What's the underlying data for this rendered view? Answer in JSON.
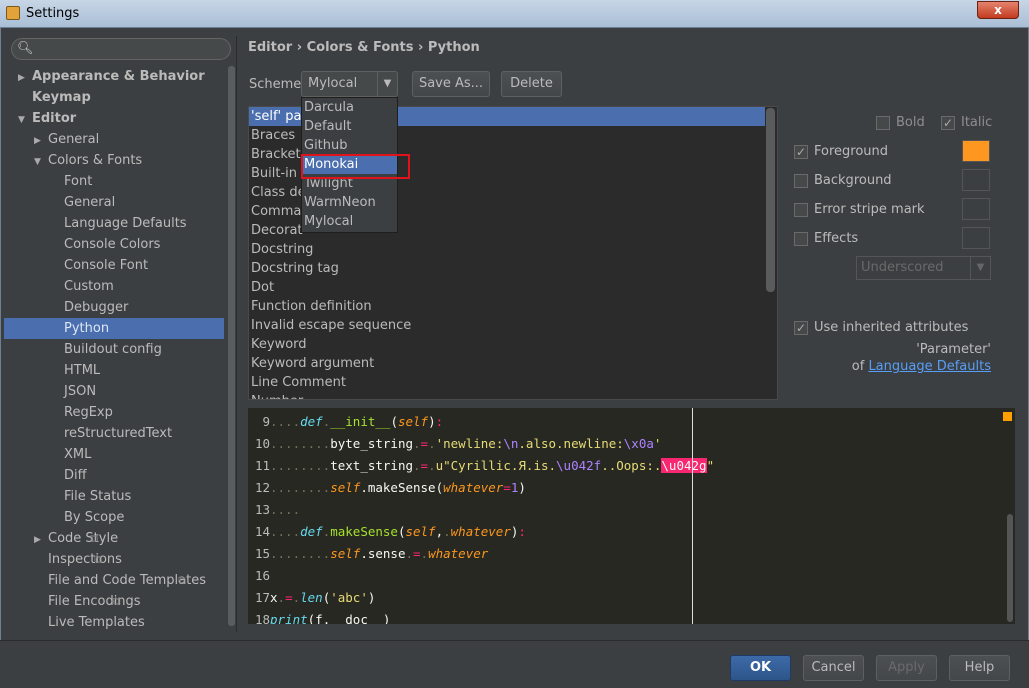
{
  "window": {
    "title": "Settings",
    "close_label": "x"
  },
  "search": {
    "placeholder": ""
  },
  "tree": [
    {
      "label": "Appearance & Behavior",
      "arrow": "▶",
      "bold": true
    },
    {
      "label": "Keymap",
      "arrow": "",
      "bold": true
    },
    {
      "label": "Editor",
      "arrow": "▼",
      "bold": true
    },
    {
      "label": "General",
      "arrow": "▶"
    },
    {
      "label": "Colors & Fonts",
      "arrow": "▼"
    },
    {
      "label": "Font"
    },
    {
      "label": "General"
    },
    {
      "label": "Language Defaults"
    },
    {
      "label": "Console Colors"
    },
    {
      "label": "Console Font"
    },
    {
      "label": "Custom"
    },
    {
      "label": "Debugger"
    },
    {
      "label": "Python",
      "selected": true
    },
    {
      "label": "Buildout config"
    },
    {
      "label": "HTML"
    },
    {
      "label": "JSON"
    },
    {
      "label": "RegExp"
    },
    {
      "label": "reStructuredText"
    },
    {
      "label": "XML"
    },
    {
      "label": "Diff"
    },
    {
      "label": "File Status"
    },
    {
      "label": "By Scope"
    },
    {
      "label": "Code Style",
      "arrow": "▶",
      "pinned": true
    },
    {
      "label": "Inspections",
      "pinned": true
    },
    {
      "label": "File and Code Templates",
      "pinned": true
    },
    {
      "label": "File Encodings",
      "pinned": true
    },
    {
      "label": "Live Templates"
    }
  ],
  "breadcrumb": "Editor › Colors & Fonts › Python",
  "scheme": {
    "label": "Scheme:",
    "value": "Mylocal",
    "save_as": "Save As...",
    "delete": "Delete",
    "options": [
      "Darcula",
      "Default",
      "Github",
      "Monokai",
      "Twilight",
      "WarmNeon",
      "Mylocal"
    ],
    "highlighted": "Monokai"
  },
  "attributes": [
    "'self' parameter",
    "Braces",
    "Brackets",
    "Built-in name",
    "Class definition",
    "Comma",
    "Decorator",
    "Docstring",
    "Docstring tag",
    "Dot",
    "Function definition",
    "Invalid escape sequence",
    "Keyword",
    "Keyword argument",
    "Line Comment",
    "Number"
  ],
  "attributes_visible_prefix": {
    "0": "'self' par",
    "2": "Bracket",
    "3": "Built-in",
    "4": "Class de",
    "5": "Comma",
    "6": "Decorat"
  },
  "options": {
    "bold": {
      "label": "Bold",
      "checked": false
    },
    "italic": {
      "label": "Italic",
      "checked": true
    },
    "foreground": {
      "label": "Foreground",
      "checked": true,
      "color": "#fd971f"
    },
    "background": {
      "label": "Background",
      "checked": false
    },
    "error_stripe": {
      "label": "Error stripe mark",
      "checked": false
    },
    "effects": {
      "label": "Effects",
      "checked": false
    },
    "effect_type": "Underscored",
    "use_inherited": {
      "label": "Use inherited attributes",
      "checked": true
    },
    "inherit_param": "'Parameter'",
    "inherit_of": "of",
    "inherit_link": "Language Defaults"
  },
  "code_lines": [
    {
      "n": "9"
    },
    {
      "n": "10"
    },
    {
      "n": "11"
    },
    {
      "n": "12"
    },
    {
      "n": "13"
    },
    {
      "n": "14"
    },
    {
      "n": "15"
    },
    {
      "n": "16"
    },
    {
      "n": "17"
    },
    {
      "n": "18"
    }
  ],
  "buttons": {
    "ok": "OK",
    "cancel": "Cancel",
    "apply": "Apply",
    "help": "Help"
  },
  "colors": {
    "accent": "#4b6eaf",
    "editor_bg": "#272822",
    "highlight_box": "#e0131b"
  }
}
